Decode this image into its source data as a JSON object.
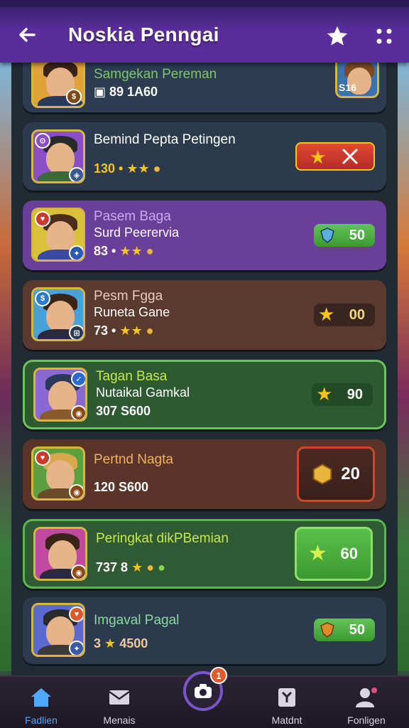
{
  "header": {
    "title": "Noskia Penngai"
  },
  "rows": [
    {
      "name": "Samgekan Pereman",
      "sub": "",
      "meta": "▣ 89 1A60",
      "pill": "",
      "right_label": "S16"
    },
    {
      "name": "Bemind Pepta Petingen",
      "sub": "",
      "meta": "130 •",
      "pill": "",
      "right_label": ""
    },
    {
      "name": "Pasem Baga",
      "sub": "Surd Peerervia",
      "meta": "83 •",
      "pill": "50",
      "right_label": ""
    },
    {
      "name": "Pesm Fgga",
      "sub": "Runeta Gane",
      "meta": "73 •",
      "pill": "00",
      "right_label": ""
    },
    {
      "name": "Tagan Basa",
      "sub": "Nutaikal Gamkal",
      "meta": "307 S600",
      "pill": "90",
      "right_label": ""
    },
    {
      "name": "Pertnd Nagta",
      "sub": "",
      "meta": "120 S600",
      "pill": "20",
      "right_label": ""
    },
    {
      "name": "Peringkat dikPBemian",
      "sub": "",
      "meta": "737 8",
      "pill": "60",
      "right_label": ""
    },
    {
      "name": "Imgaval Pagal",
      "sub": "",
      "meta": "3",
      "meta2": "4500",
      "pill": "50",
      "right_label": ""
    }
  ],
  "nav": {
    "items": [
      {
        "label": "Fadlien",
        "icon": "home-icon"
      },
      {
        "label": "Menais",
        "icon": "mail-icon"
      },
      {
        "label": "",
        "icon": "camera-icon",
        "badge": "1"
      },
      {
        "label": "Matdnt",
        "icon": "trophy-icon"
      },
      {
        "label": "Fonligen",
        "icon": "profile-icon"
      }
    ]
  }
}
